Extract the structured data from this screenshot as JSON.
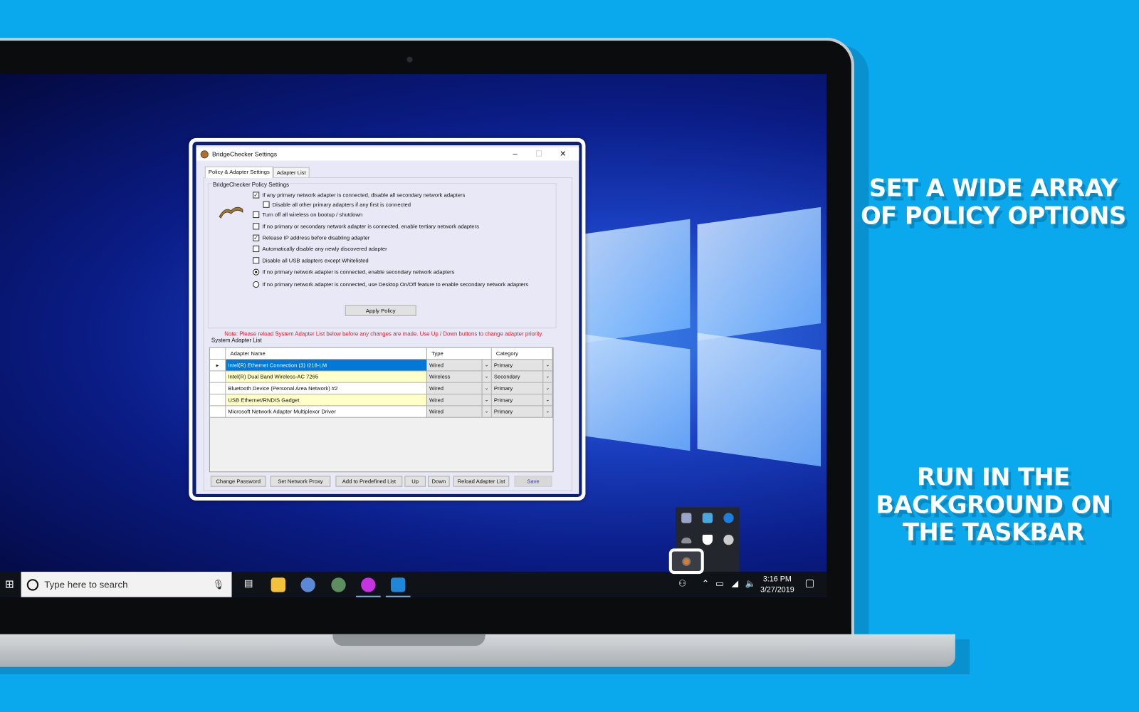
{
  "headlines": {
    "top": "SET A WIDE ARRAY OF POLICY OPTIONS",
    "bottom": "RUN IN THE BACKGROUND ON THE TASKBAR"
  },
  "dialog": {
    "title": "BridgeChecker Settings",
    "window_buttons": {
      "minimize": "–",
      "maximize": "☐",
      "close": "✕"
    },
    "tabs": [
      "Policy & Adapter Settings",
      "Adapter List"
    ],
    "active_tab": "Policy & Adapter Settings",
    "group_label": "BridgeChecker Policy Settings",
    "options": [
      {
        "type": "checkbox",
        "checked": true,
        "label": "If any primary network adapter is connected, disable all secondary network adapters"
      },
      {
        "type": "checkbox",
        "checked": false,
        "label": "Disable all other primary adapters if any first is connected"
      },
      {
        "type": "checkbox",
        "checked": false,
        "label": "Turn off all wireless on bootup / shutdown"
      },
      {
        "type": "checkbox",
        "checked": false,
        "label": "If no primary or secondary network adapter is connected, enable tertiary network adapters"
      },
      {
        "type": "checkbox",
        "checked": true,
        "label": "Release IP address before disabling adapter"
      },
      {
        "type": "checkbox",
        "checked": false,
        "label": "Automatically disable any newly discovered adapter"
      },
      {
        "type": "checkbox",
        "checked": false,
        "label": "Disable all USB adapters except Whitelisted"
      },
      {
        "type": "radio",
        "checked": true,
        "label": "If no primary network adapter is connected, enable secondary network adapters"
      },
      {
        "type": "radio",
        "checked": false,
        "label": "If no primary network adapter is connected, use Desktop On/Off feature to enable secondary network adapters"
      }
    ],
    "apply_button": "Apply Policy",
    "note": "Note: Please reload System Adapter List below before any changes are made. Use Up / Down buttons to change adapter priority.",
    "list_label": "System Adapter List",
    "columns": [
      "Adapter Name",
      "Type",
      "Category"
    ],
    "rows": [
      {
        "name": "Intel(R) Ethernet Connection (3) I218-LM",
        "type": "Wired",
        "category": "Primary"
      },
      {
        "name": "Intel(R) Dual Band Wireless-AC 7265",
        "type": "Wireless",
        "category": "Secondary"
      },
      {
        "name": "Bluetooth Device (Personal Area Network) #2",
        "type": "Wired",
        "category": "Primary"
      },
      {
        "name": "USB Ethernet/RNDIS Gadget",
        "type": "Wired",
        "category": "Primary"
      },
      {
        "name": "Microsoft Network Adapter Multiplexor Driver",
        "type": "Wired",
        "category": "Primary"
      }
    ],
    "buttons": [
      "Change Password",
      "Set Network Proxy",
      "Add to Predefined List",
      "Up",
      "Down",
      "Reload Adapter List",
      "Save"
    ]
  },
  "taskbar": {
    "search_placeholder": "Type here to search",
    "time": "3:16 PM",
    "date": "3/27/2019"
  },
  "colors": {
    "background": "#0aa9ee",
    "selection": "#0078d7",
    "note": "#e8192c",
    "highlight_row": "#ffffc8"
  }
}
